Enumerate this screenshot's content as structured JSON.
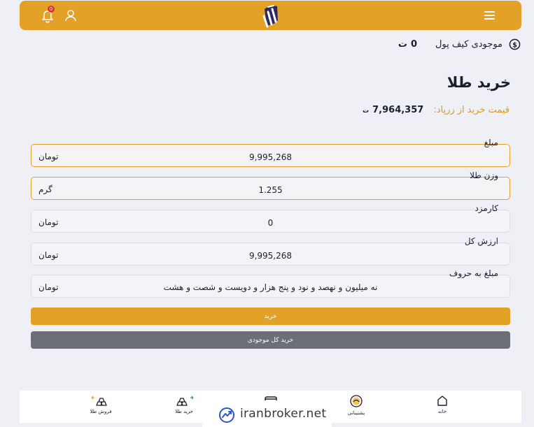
{
  "header": {
    "notification_count": "0",
    "icons": [
      "menu-icon",
      "logo",
      "user-icon",
      "bell-icon"
    ],
    "color": "#e3a127"
  },
  "wallet": {
    "label": "موجودی کیف پول",
    "amount": "0",
    "unit": "ت",
    "icon": "dollar-circle-icon"
  },
  "page": {
    "title": "خرید طلا",
    "price_label": "قیمت خرید از زرپاد:",
    "price_value": "7,964,357",
    "price_unit": "ت"
  },
  "fields": [
    {
      "label": "مبلغ",
      "value": "9,995,268",
      "unit": "تومان",
      "active": true
    },
    {
      "label": "وزن طلا",
      "value": "1.255",
      "unit": "گرم",
      "active": true
    },
    {
      "label": "کارمزد",
      "value": "0",
      "unit": "تومان",
      "active": false
    },
    {
      "label": "ارزش کل",
      "value": "9,995,268",
      "unit": "تومان",
      "active": false
    },
    {
      "label": "مبلغ به حروف",
      "value": "نه میلیون و نهصد و نود و پنج هزار و دویست و شصت و هشت",
      "unit": "تومان",
      "active": false
    }
  ],
  "buttons": {
    "buy": "خرید",
    "buy_all": "خرید کل موجودی"
  },
  "bottom_nav": [
    {
      "label": "فروش طلا",
      "icon": "gold-bars-sell-icon"
    },
    {
      "label": "خرید طلا",
      "icon": "gold-bars-buy-icon"
    },
    {
      "label": "",
      "icon": "wallet-card-icon"
    },
    {
      "label": "پشتیبانی",
      "icon": "support-icon"
    },
    {
      "label": "خانه",
      "icon": "home-icon"
    }
  ],
  "watermark": {
    "text": "iranbroker.net",
    "icon": "chart-growth-icon"
  },
  "colors": {
    "accent": "#e3a127",
    "secondary_button": "#6c6f76",
    "price_label": "#d49a2c",
    "background": "#eff0f6"
  }
}
